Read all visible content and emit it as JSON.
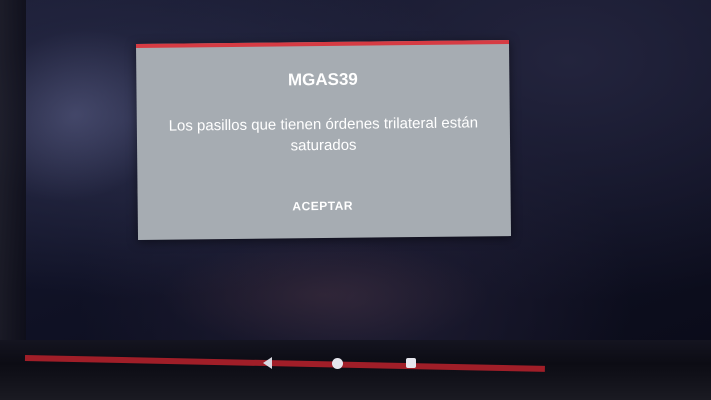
{
  "dialog": {
    "title": "MGAS39",
    "message": "Los pasillos que tienen órdenes trilateral están saturados",
    "button_label": "ACEPTAR",
    "accent_color": "#d63b43",
    "background_color": "#a6acb2"
  },
  "navbar": {
    "icons": [
      "back-triangle-icon",
      "home-circle-icon",
      "recents-square-icon"
    ]
  }
}
